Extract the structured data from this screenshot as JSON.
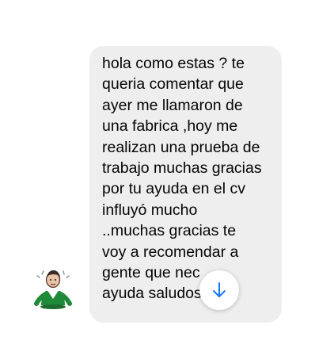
{
  "message": {
    "text_lines": [
      "hola como estas ? te",
      "queria comentar que",
      "ayer me llamaron de",
      "una fabrica ,hoy me",
      "realizan una prueba de",
      "trabajo muchas gracias",
      "por tu ayuda en el cv",
      "influyó mucho",
      "..muchas gracias te",
      "voy a recomendar a",
      "gente que nec",
      "ayuda saludos"
    ],
    "bubble_color": "#eeeeef",
    "text_color": "#050505"
  },
  "avatar": {
    "icon": "avatar-illustration"
  },
  "scroll_down_button": {
    "icon": "arrow-down-icon",
    "accent_color": "#1877f2"
  }
}
